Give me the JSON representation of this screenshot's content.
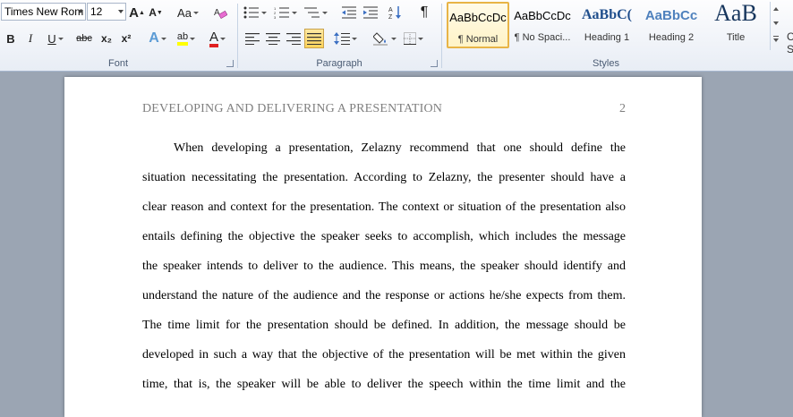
{
  "ribbon": {
    "font": {
      "label": "Font",
      "font_name": "Times New Rom",
      "font_size": "12",
      "change_case_label": "Aa",
      "bold": "B",
      "italic": "I",
      "underline": "U",
      "strike": "abc",
      "subscript": "x₂",
      "superscript": "x²",
      "grow_label": "A",
      "shrink_label": "A",
      "text_effects": "A",
      "highlight": "ab",
      "font_color": "A"
    },
    "paragraph": {
      "label": "Paragraph",
      "pilcrow": "¶"
    },
    "styles": {
      "label": "Styles",
      "items": [
        {
          "sample": "AaBbCcDc",
          "name": "¶ Normal"
        },
        {
          "sample": "AaBbCcDc",
          "name": "¶ No Spaci..."
        },
        {
          "sample": "AaBbC(",
          "name": "Heading 1"
        },
        {
          "sample": "AaBbCc",
          "name": "Heading 2"
        },
        {
          "sample": "AaB",
          "name": "Title"
        }
      ],
      "overflow_chars": [
        "C",
        "S"
      ]
    },
    "colors": {
      "highlight": "#ffff00",
      "font_color": "#e02020",
      "heading": "#1f4e8c"
    }
  },
  "document": {
    "header_text": "DEVELOPING AND DELIVERING A PRESENTATION",
    "page_number": "2",
    "lines": [
      "When developing a presentation, Zelazny recommend that one should define the",
      "situation necessitating the presentation. According to Zelazny, the presenter should have a",
      "clear reason and context for the presentation. The context or situation of the presentation also",
      "entails defining the objective the speaker seeks to accomplish, which includes the message",
      "the speaker intends to deliver to the audience. This means, the speaker should identify and",
      "understand the nature of the audience and the response or actions he/she expects from them.",
      "The time limit for the presentation should be defined. In addition, the message should be",
      "developed in such a way that the objective of the presentation will be met within the given",
      "time, that is, the speaker will be able to deliver the speech within the time limit and the"
    ]
  }
}
